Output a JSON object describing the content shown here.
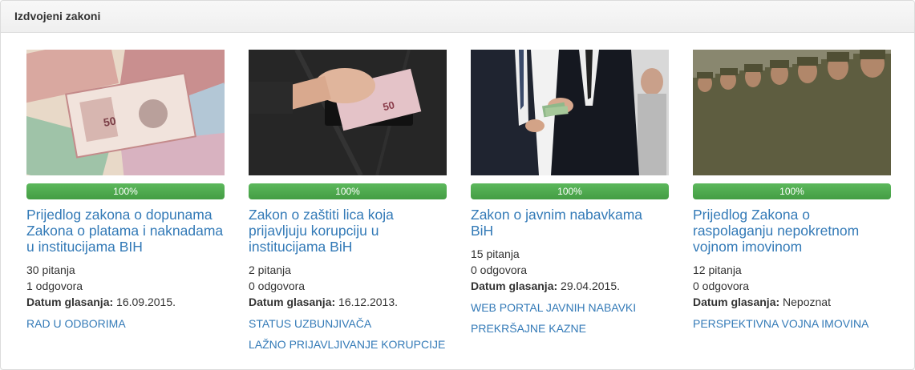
{
  "panel": {
    "title": "Izdvojeni zakoni"
  },
  "colors": {
    "link": "#337ab7",
    "progress": "#5cb85c"
  },
  "cards": [
    {
      "image": "banknotes-photo",
      "progress": 100,
      "progress_label": "100%",
      "title": "Prijedlog zakona o dopunama Zakona o platama i naknadama u institucijama BIH",
      "questions": "30 pitanja",
      "answers": "1 odgovora",
      "date_label": "Datum glasanja:",
      "date_value": "16.09.2015.",
      "tags": [
        "RAD U ODBORIMA"
      ]
    },
    {
      "image": "pocket-bribe-photo",
      "progress": 100,
      "progress_label": "100%",
      "title": "Zakon o zaštiti lica koja prijavljuju korupciju u institucijama BiH",
      "questions": "2 pitanja",
      "answers": "0 odgovora",
      "date_label": "Datum glasanja:",
      "date_value": "16.12.2013.",
      "tags": [
        "STATUS UZBUNJIVAČA",
        "LAŽNO PRIJAVLJIVANJE KORUPCIJE"
      ]
    },
    {
      "image": "handshake-money-photo",
      "progress": 100,
      "progress_label": "100%",
      "title": "Zakon o javnim nabavkama BiH",
      "questions": "15 pitanja",
      "answers": "0 odgovora",
      "date_label": "Datum glasanja:",
      "date_value": "29.04.2015.",
      "tags": [
        "WEB PORTAL JAVNIH NABAVKI",
        "PREKRŠAJNE KAZNE"
      ]
    },
    {
      "image": "soldiers-photo",
      "progress": 100,
      "progress_label": "100%",
      "title": "Prijedlog Zakona o raspolaganju nepokretnom vojnom imovinom",
      "questions": "12 pitanja",
      "answers": "0 odgovora",
      "date_label": "Datum glasanja:",
      "date_value": "Nepoznat",
      "tags": [
        "PERSPEKTIVNA VOJNA IMOVINA"
      ]
    }
  ]
}
